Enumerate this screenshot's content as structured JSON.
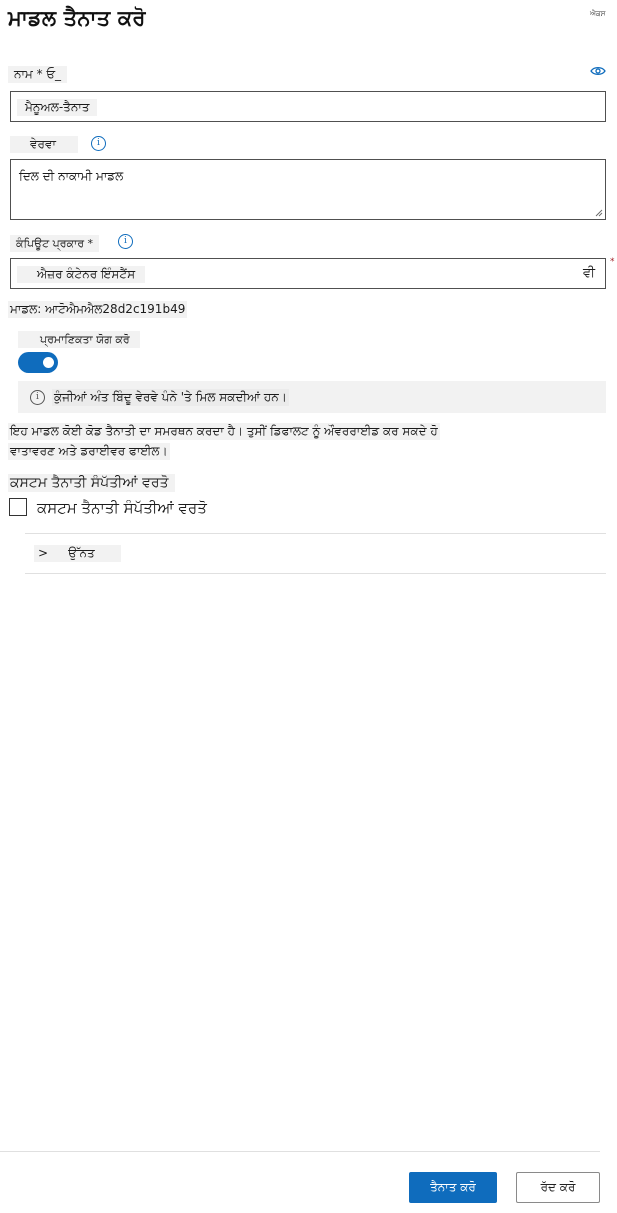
{
  "panel": {
    "title": "ਮਾਡਲ ਤੈਨਾਤ ਕਰੋ",
    "corner_label": "ਐਕਸ"
  },
  "name_field": {
    "label": "ਨਾਮ * ਓ_",
    "value": "ਮੈਨੂਅਲ-ਤੈਨਾਤ",
    "icon": "eye-icon"
  },
  "description_field": {
    "label": "ਵੇਰਵਾ",
    "info_icon": "i",
    "value": "ਦਿਲ ਦੀ ਨਾਕਾਮੀ ਮਾਡਲ"
  },
  "compute_type": {
    "label": "ਕੰਪਿਊਟ ਪ੍ਰਕਾਰ *",
    "info_icon": "i",
    "selected": "ਐਜ਼ਰ ਕੰਟੇਨਰ ਇੰਸਟੈਂਸ",
    "selected_tail": "ਵੀ",
    "required_mark": "*"
  },
  "model_line": "ਮਾਡਲ: ਆਟੋਐਮਐਲ28d2c191b49",
  "auth": {
    "label": "ਪ੍ਰਮਾਣਿਕਤਾ ਯੋਗ ਕਰੋ",
    "enabled": true,
    "info_icon": "i",
    "banner_text": "ਕੁੰਜੀਆਂ ਅੰਤ ਬਿੰਦੂ ਵੇਰਵੇ ਪੰਨੇ 'ਤੇ ਮਿਲ ਸਕਦੀਆਂ ਹਨ।"
  },
  "no_code": {
    "line1": "ਇਹ ਮਾਡਲ ਕੋਈ ਕੋਡ ਤੈਨਾਤੀ ਦਾ ਸਮਰਥਨ ਕਰਦਾ ਹੈ। ਤੁਸੀਂ ਡਿਫਾਲਟ ਨੂੰ ਔਵਰਰਾਈਡ ਕਰ ਸਕਦੇ ਹੋ",
    "line2": "ਵਾਤਾਵਰਣ ਅਤੇ ਡਰਾਈਵਰ ਫਾਈਲ।"
  },
  "custom": {
    "heading": "ਕਸਟਮ ਤੈਨਾਤੀ ਸੰਪੱਤੀਆਂ ਵਰਤੋ",
    "checkbox_label": "ਕਸਟਮ ਤੈਨਾਤੀ ਸੰਪੱਤੀਆਂ ਵਰਤੋ",
    "checked": false
  },
  "advanced": {
    "chevron": ">",
    "label": "ਉੱਨਤ"
  },
  "footer": {
    "deploy_label": "ਤੈਨਾਤ ਕਰੋ",
    "cancel_label": "ਰੱਦ ਕਰੋ"
  },
  "colors": {
    "accent": "#0f6cbd",
    "label_background": "#f2f2f2",
    "border": "#505050"
  }
}
